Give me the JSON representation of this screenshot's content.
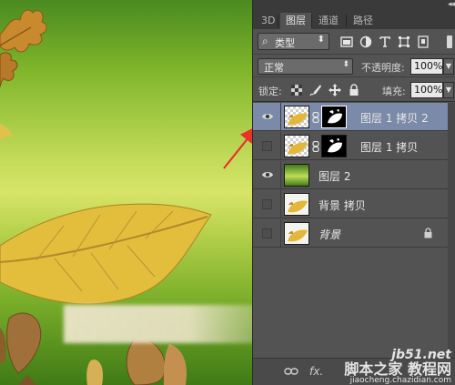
{
  "canvas": {
    "layer_description": "autumn-leaf-composite"
  },
  "panel": {
    "tabs": [
      {
        "label": "3D",
        "active": false
      },
      {
        "label": "图层",
        "active": true
      },
      {
        "label": "通道",
        "active": false
      },
      {
        "label": "路径",
        "active": false
      }
    ],
    "menu_arrows": "◂◂",
    "filter": {
      "kind_label": "类型",
      "icons": [
        "image-filter-icon",
        "adjustment-filter-icon",
        "text-filter-icon",
        "shape-filter-icon",
        "smart-object-filter-icon"
      ]
    },
    "blend_mode": "正常",
    "opacity_label": "不透明度:",
    "opacity_value": "100%",
    "lock_label": "锁定:",
    "fill_label": "填充:",
    "fill_value": "100%",
    "layers": [
      {
        "name": "图层 1 拷贝 2",
        "visible": true,
        "selected": true,
        "has_mask": true,
        "thumb": "leaf",
        "italic": false,
        "locked": false
      },
      {
        "name": "图层 1 拷贝",
        "visible": false,
        "selected": false,
        "has_mask": true,
        "thumb": "leaf",
        "italic": false,
        "locked": false
      },
      {
        "name": "图层 2",
        "visible": true,
        "selected": false,
        "has_mask": false,
        "thumb": "gradient",
        "italic": false,
        "locked": false
      },
      {
        "name": "背景 拷贝",
        "visible": false,
        "selected": false,
        "has_mask": false,
        "thumb": "leaf-white",
        "italic": false,
        "locked": false
      },
      {
        "name": "背景",
        "visible": false,
        "selected": false,
        "has_mask": false,
        "thumb": "leaf-white",
        "italic": true,
        "locked": true
      }
    ],
    "bottom_icons": [
      "link-icon",
      "fx-icon"
    ],
    "fx_label": "fx."
  },
  "watermark": {
    "line1": "jb51.net",
    "line2": "脚本之家 教程网",
    "line3": "jiaocheng.chazidian.com"
  },
  "colors": {
    "panel_bg": "#535353",
    "selected_row": "#7a8aa8",
    "annotation_arrow": "#e8332a"
  }
}
